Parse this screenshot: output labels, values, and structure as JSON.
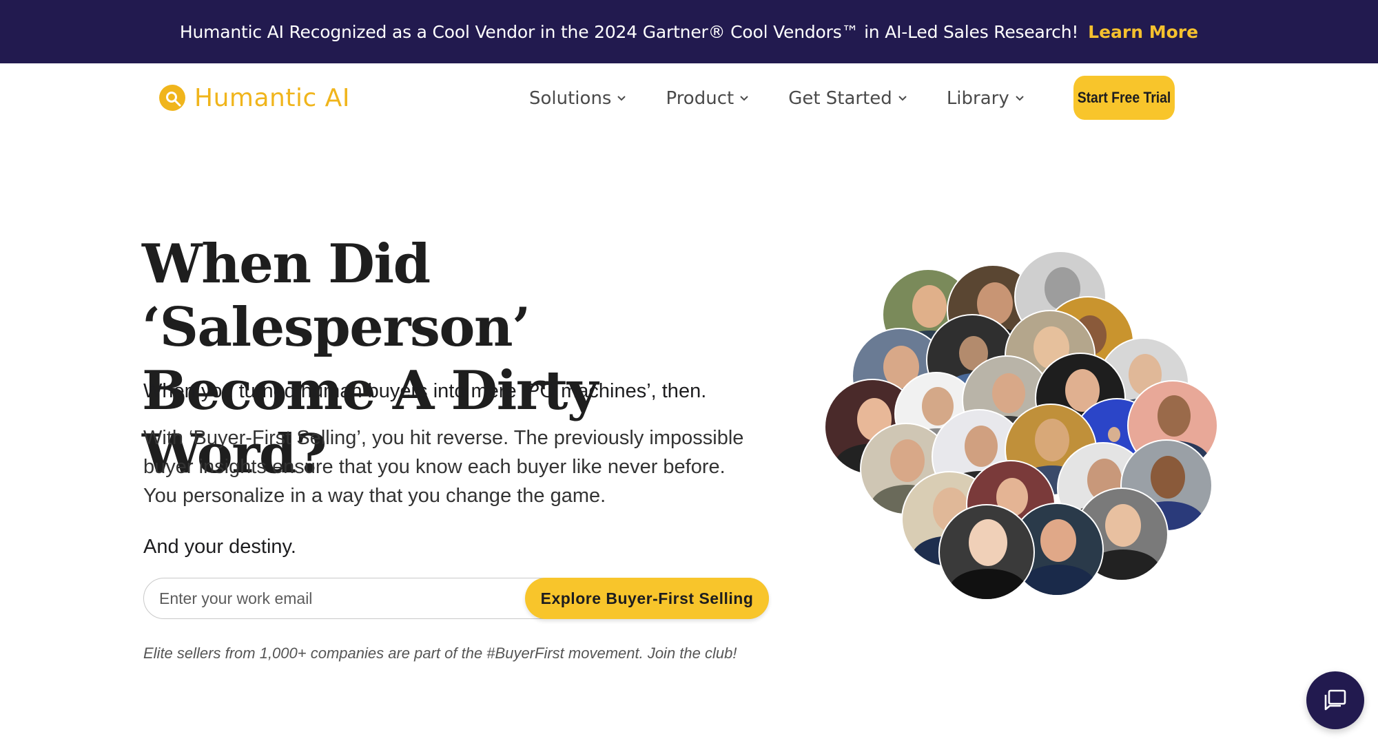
{
  "announcement": {
    "message": "Humantic AI Recognized as a Cool Vendor in the 2024 Gartner® Cool Vendors™ in AI-Led Sales Research!",
    "link_label": "Learn More"
  },
  "nav": {
    "logo_text": "Humantic AI",
    "menu": [
      {
        "label": "Solutions",
        "icon": "chevron-down-icon"
      },
      {
        "label": "Product",
        "icon": "chevron-down-icon"
      },
      {
        "label": "Get Started",
        "icon": "chevron-down-icon"
      },
      {
        "label": "Library",
        "icon": "chevron-down-icon"
      }
    ],
    "cta_label": "Start Free Trial"
  },
  "hero": {
    "title_line1": "When Did ‘Salesperson’",
    "title_line2": "Become A Dirty Word?",
    "lead": "When you turned human buyers into mere ‘PO machines’, then.",
    "body": "With ‘Buyer-First Selling’, you hit reverse. The previously impossible buyer insights ensure that you know each buyer like never before. You personalize in a way that you change the game.",
    "destiny": "And your destiny.",
    "email_placeholder": "Enter your work email",
    "email_value": "",
    "explore_label": "Explore Buyer-First Selling",
    "elite_note": "Elite sellers from 1,000+ companies are part of the #BuyerFirst movement. Join the club!"
  },
  "colors": {
    "announcement_bg": "#221a4f",
    "brand_yellow": "#f8c52b",
    "logo_yellow": "#f0b51c",
    "chat_bg": "#221a4f"
  },
  "chat": {
    "icon": "chat-icon"
  }
}
